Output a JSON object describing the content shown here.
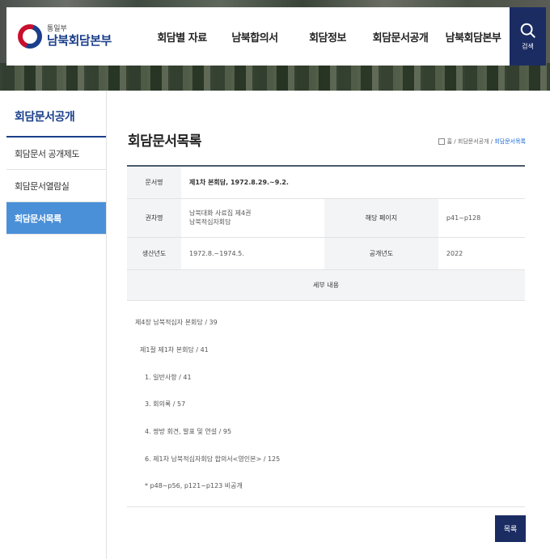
{
  "header": {
    "logo_sub": "통일부",
    "logo_main": "남북회담본부",
    "nav": [
      "회담별 자료",
      "남북합의서",
      "회담정보",
      "회담문서공개",
      "남북회담본부"
    ],
    "search_label": "검색"
  },
  "sidebar": {
    "title": "회담문서공개",
    "items": [
      {
        "label": "회담문서 공개제도"
      },
      {
        "label": "회담문서열람실"
      },
      {
        "label": "회담문서목록"
      }
    ]
  },
  "main": {
    "title": "회담문서목록",
    "breadcrumb": {
      "home": "홈",
      "sep": "/",
      "parent": "회담문서공개",
      "current": "회담문서목록"
    },
    "doc": {
      "name_label": "문서명",
      "name_value": "제1차 본회담, 1972.8.29.~9.2.",
      "volume_label": "권차명",
      "volume_line1": "남북대화 사료집 제4권",
      "volume_line2": "남북적십자회담",
      "page_label": "해당 페이지",
      "page_value": "p41~p128",
      "produced_label": "생산년도",
      "produced_value": "1972.8.~1974.5.",
      "open_label": "공개년도",
      "open_value": "2022",
      "detail_label": "세부 내용"
    },
    "details": [
      "제4장 남북적십자 본회담 / 39",
      "제1절 제1차 본회담 / 41",
      "1. 일반사항 / 41",
      "3. 회의록 / 57",
      "4. 쌍방 회견, 발표 및 연설 / 95",
      "6. 제1차 남북적십자회담 합의서<영인본> / 125",
      "* p48~p56, p121~p123 비공개"
    ],
    "list_button": "목록"
  }
}
